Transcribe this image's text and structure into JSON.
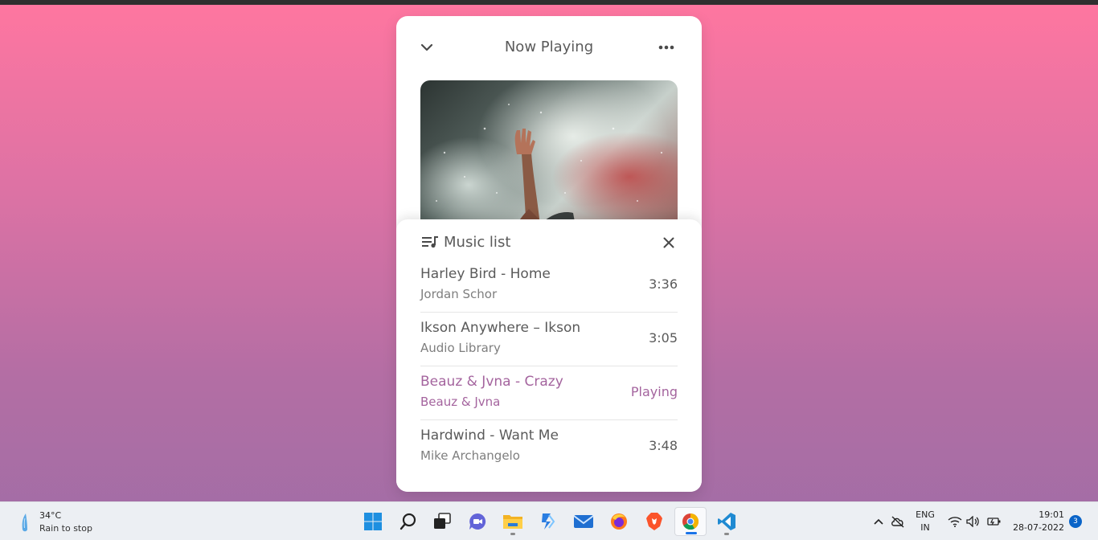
{
  "player": {
    "header_title": "Now Playing",
    "music_list": {
      "title": "Music list",
      "songs": [
        {
          "name": "Harley Bird - Home",
          "artist": "Jordan Schor",
          "duration": "3:36",
          "playing": false
        },
        {
          "name": "Ikson Anywhere – Ikson",
          "artist": "Audio Library",
          "duration": "3:05",
          "playing": false
        },
        {
          "name": "Beauz & Jvna - Crazy",
          "artist": "Beauz & Jvna",
          "duration": "Playing",
          "playing": true
        },
        {
          "name": "Hardwind - Want Me",
          "artist": "Mike Archangelo",
          "duration": "3:48",
          "playing": false
        }
      ]
    }
  },
  "taskbar": {
    "weather": {
      "temp": "34°C",
      "desc": "Rain to stop"
    },
    "apps": [
      {
        "name": "Start",
        "icon": "windows-icon"
      },
      {
        "name": "Search",
        "icon": "search-icon"
      },
      {
        "name": "Task View",
        "icon": "task-view-icon"
      },
      {
        "name": "Chat",
        "icon": "chat-icon"
      },
      {
        "name": "File Explorer",
        "icon": "folder-icon"
      },
      {
        "name": "Power Automate",
        "icon": "power-automate-icon"
      },
      {
        "name": "Mail",
        "icon": "mail-icon"
      },
      {
        "name": "Firefox",
        "icon": "firefox-icon"
      },
      {
        "name": "Brave",
        "icon": "brave-icon"
      },
      {
        "name": "Chrome",
        "icon": "chrome-icon"
      },
      {
        "name": "VS Code",
        "icon": "vscode-icon"
      }
    ],
    "lang_line1": "ENG",
    "lang_line2": "IN",
    "time": "19:01",
    "date": "28-07-2022",
    "notification_count": "3"
  },
  "colors": {
    "accent_playing": "#a4649e",
    "bg_top": "#ff76a0",
    "bg_bottom": "#a06da6"
  }
}
